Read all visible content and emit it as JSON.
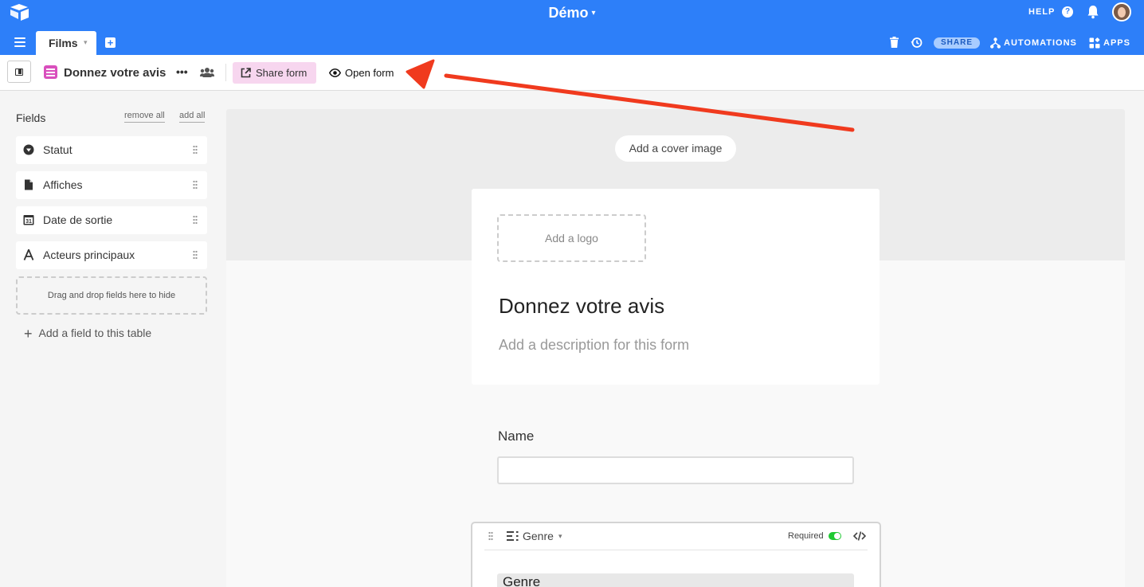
{
  "base": {
    "title": "Démo",
    "caret": "▾"
  },
  "topbar": {
    "help_label": "HELP",
    "help_icon": "?",
    "share_label": "SHARE",
    "automations_label": "AUTOMATIONS",
    "apps_label": "APPS",
    "accent_color": "#2d7ff9"
  },
  "tabs": [
    {
      "label": "Films",
      "caret": "▾",
      "active": true
    }
  ],
  "viewbar": {
    "view_name": "Donnez votre avis",
    "more_icon": "•••",
    "share_form_label": "Share form",
    "open_form_label": "Open form",
    "view_icon_color": "#d94fbd"
  },
  "fields_panel": {
    "title": "Fields",
    "remove_all": "remove all",
    "add_all": "add all",
    "items": [
      {
        "label": "Statut",
        "icon": "single-select-icon"
      },
      {
        "label": "Affiches",
        "icon": "attachment-icon"
      },
      {
        "label": "Date de sortie",
        "icon": "calendar-icon"
      },
      {
        "label": "Acteurs principaux",
        "icon": "text-icon"
      }
    ],
    "drop_zone": "Drag and drop fields here to hide",
    "add_field_plus": "+",
    "add_field": "Add a field to this table"
  },
  "form": {
    "cover_button": "Add a cover image",
    "logo_placeholder": "Add a logo",
    "title": "Donnez votre avis",
    "description_placeholder": "Add a description for this form",
    "name_field": {
      "label": "Name",
      "value": ""
    },
    "genre_field": {
      "name": "Genre",
      "caret": "▾",
      "required_label": "Required",
      "required": true,
      "label": "Genre",
      "toggle_color": "#20c933"
    }
  },
  "annotation": {
    "arrow_color": "#f03a1e"
  }
}
